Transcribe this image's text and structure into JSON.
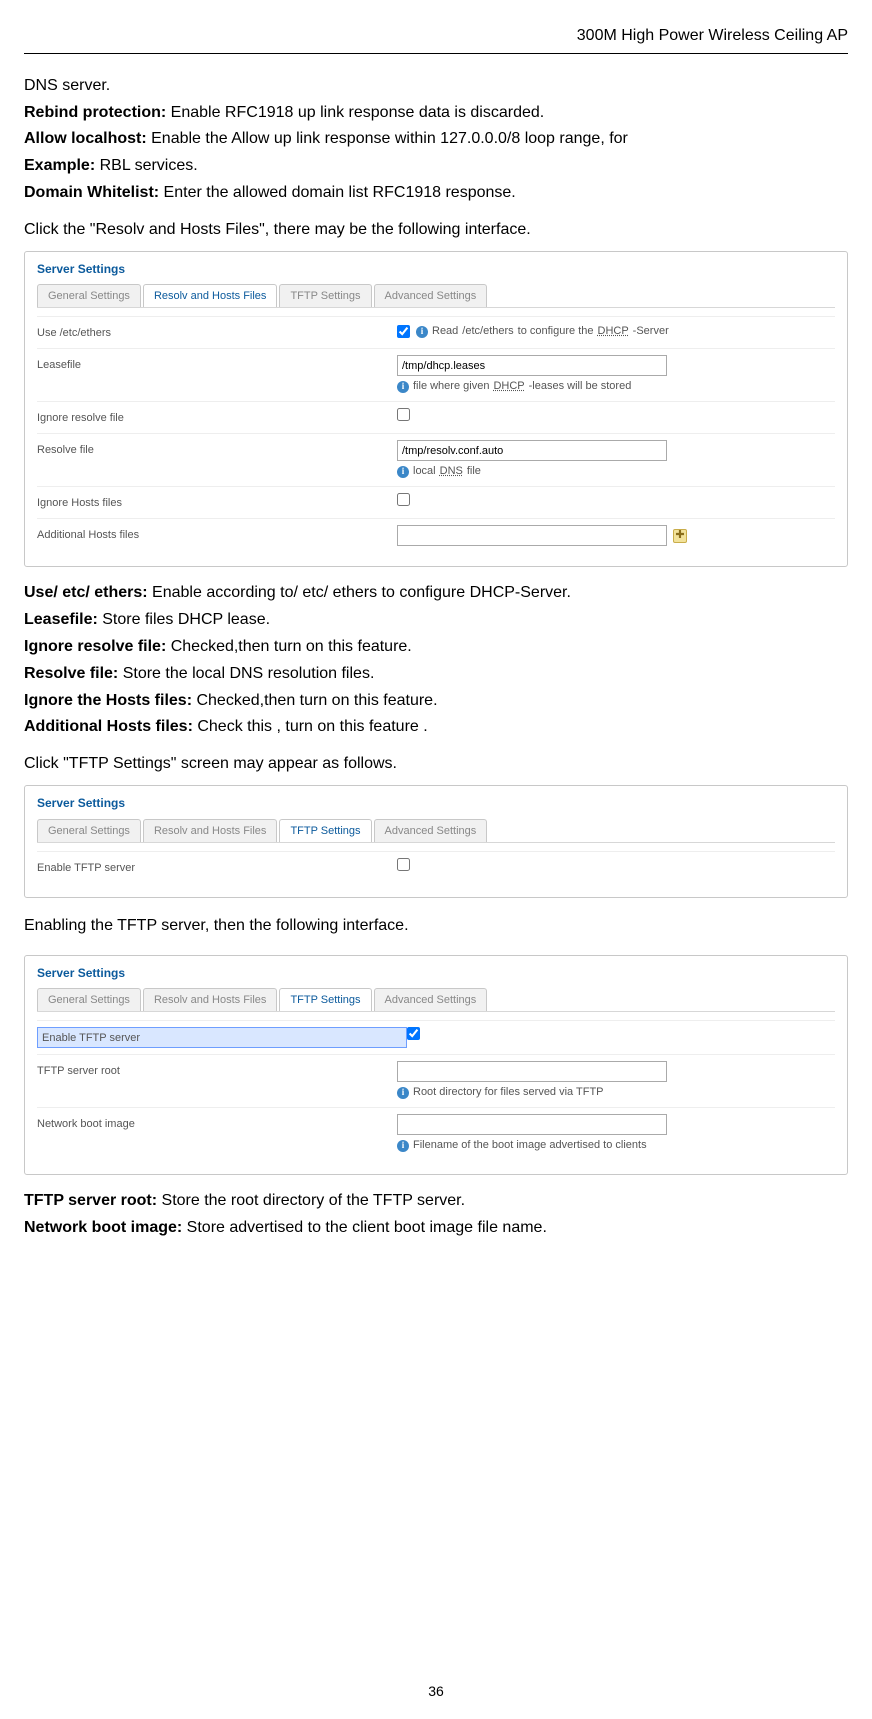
{
  "header": "300M High Power Wireless Ceiling AP",
  "intro": {
    "dns_server": "DNS server.",
    "rebind_bold": "Rebind protection:",
    "rebind_text": " Enable RFC1918 up link response data is discarded.",
    "allow_bold": "Allow localhost:",
    "allow_text": " Enable the Allow up link response within 127.0.0.0/8 loop range, for",
    "example_bold": "Example:",
    "example_text": " RBL services.",
    "domain_bold": "Domain Whitelist:",
    "domain_text": " Enter the allowed domain list RFC1918 response.",
    "click_resolv": "Click the \"Resolv and Hosts Files\", there may be the following interface."
  },
  "panel1": {
    "legend": "Server Settings",
    "tabs": [
      "General Settings",
      "Resolv and Hosts Files",
      "TFTP Settings",
      "Advanced Settings"
    ],
    "active_tab": 1,
    "rows": {
      "use_ethers_label": "Use /etc/ethers",
      "use_ethers_checked": true,
      "use_ethers_desc_pre": "Read ",
      "use_ethers_code": "/etc/ethers",
      "use_ethers_desc_mid": " to configure the ",
      "use_ethers_dhcp": "DHCP",
      "use_ethers_desc_post": "-Server",
      "leasefile_label": "Leasefile",
      "leasefile_value": "/tmp/dhcp.leases",
      "leasefile_desc_pre": "file where given ",
      "leasefile_dhcp": "DHCP",
      "leasefile_desc_post": "-leases will be stored",
      "ignore_resolve_label": "Ignore resolve file",
      "ignore_resolve_checked": false,
      "resolve_file_label": "Resolve file",
      "resolve_file_value": "/tmp/resolv.conf.auto",
      "resolve_file_desc_pre": "local ",
      "resolve_file_dns": "DNS",
      "resolve_file_desc_post": " file",
      "ignore_hosts_label": "Ignore Hosts files",
      "ignore_hosts_checked": false,
      "additional_hosts_label": "Additional Hosts files",
      "additional_hosts_value": ""
    }
  },
  "defs1": {
    "d1b": "Use/ etc/ ethers:",
    "d1t": " Enable according to/ etc/ ethers to configure DHCP-Server.",
    "d2b": "Leasefile:",
    "d2t": " Store files DHCP lease.",
    "d3b": "Ignore resolve file:",
    "d3t": " Checked,then turn on this feature.",
    "d4b": "Resolve file:",
    "d4t": " Store the local DNS resolution files.",
    "d5b": "Ignore the Hosts files:",
    "d5t": " Checked,then turn on this feature.",
    "d6b": "Additional Hosts files:",
    "d6t": " Check this , turn on this feature .",
    "click_tftp": "Click \"TFTP Settings\" screen may appear as follows."
  },
  "panel2": {
    "legend": "Server Settings",
    "tabs": [
      "General Settings",
      "Resolv and Hosts Files",
      "TFTP Settings",
      "Advanced Settings"
    ],
    "active_tab": 2,
    "enable_tftp_label": "Enable TFTP server",
    "enable_tftp_checked": false
  },
  "between23": "Enabling the TFTP server, then the following interface.",
  "panel3": {
    "legend": "Server Settings",
    "tabs": [
      "General Settings",
      "Resolv and Hosts Files",
      "TFTP Settings",
      "Advanced Settings"
    ],
    "active_tab": 2,
    "enable_tftp_label": "Enable TFTP server",
    "enable_tftp_checked": true,
    "tftp_root_label": "TFTP server root",
    "tftp_root_value": "",
    "tftp_root_desc": "Root directory for files served via TFTP",
    "netboot_label": "Network boot image",
    "netboot_value": "",
    "netboot_desc": "Filename of the boot image advertised to clients"
  },
  "defs3": {
    "d1b": "TFTP server root:",
    "d1t": " Store the root directory of the TFTP server.",
    "d2b": "Network boot image:",
    "d2t": " Store advertised to the client boot image file name."
  },
  "page_number": "36"
}
